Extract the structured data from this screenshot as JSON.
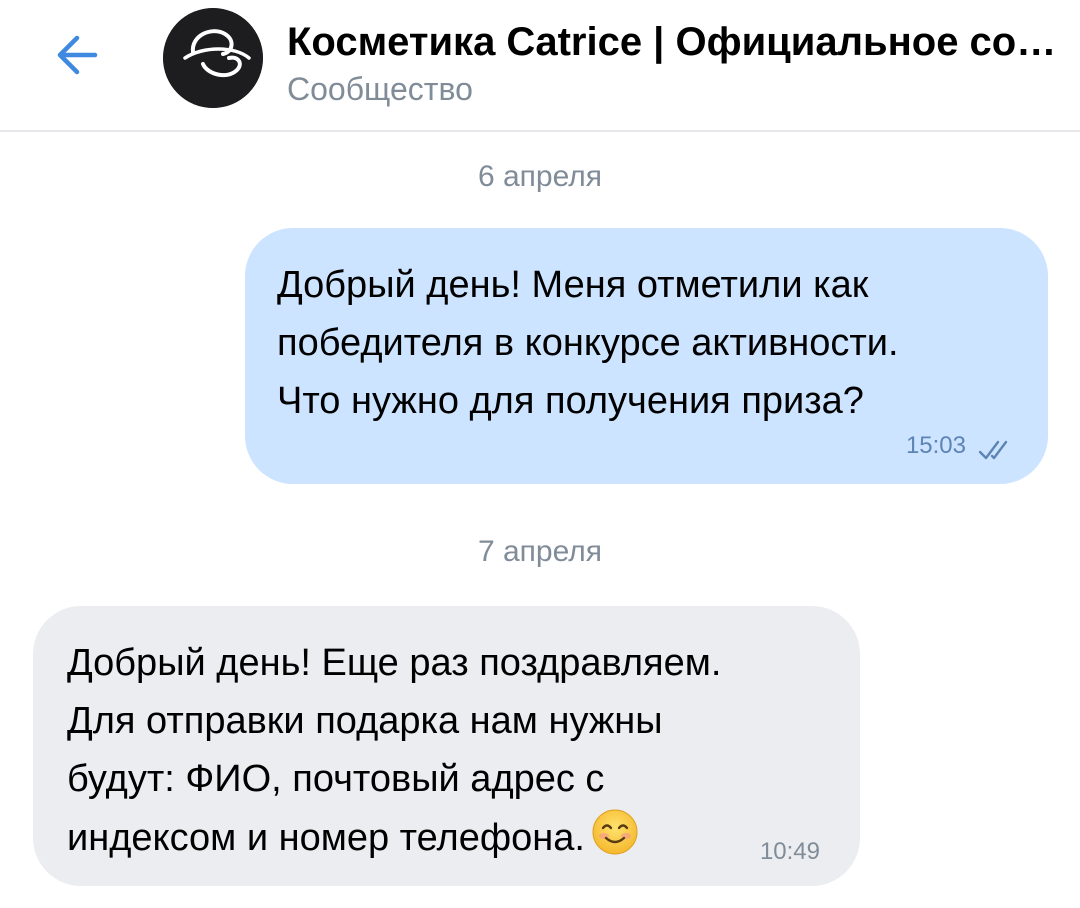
{
  "header": {
    "title": "Косметика Catrice | Официальное сообщество",
    "subtitle": "Сообщество",
    "back_icon": "arrow-left-icon",
    "avatar_icon": "catrice-logo"
  },
  "colors": {
    "accent": "#3f8ae0",
    "outgoing_bubble": "#cce4ff",
    "incoming_bubble": "#ebedf0",
    "secondary_text": "#818c99"
  },
  "messages": [
    {
      "date": "6 апреля",
      "direction": "outgoing",
      "text": "Добрый день! Меня отметили как\nпобедителя в конкурсе активности.\nЧто нужно для получения приза?",
      "time": "15:03",
      "status_icon": "double-check-icon"
    },
    {
      "date": "7 апреля",
      "direction": "incoming",
      "text": "Добрый день! Еще раз поздравляем.\nДля отправки подарка нам нужны\nбудут: ФИО, почтовый адрес с\nиндексом и номер телефона.",
      "emoji": "smiling-face-emoji",
      "time": "10:49"
    }
  ]
}
